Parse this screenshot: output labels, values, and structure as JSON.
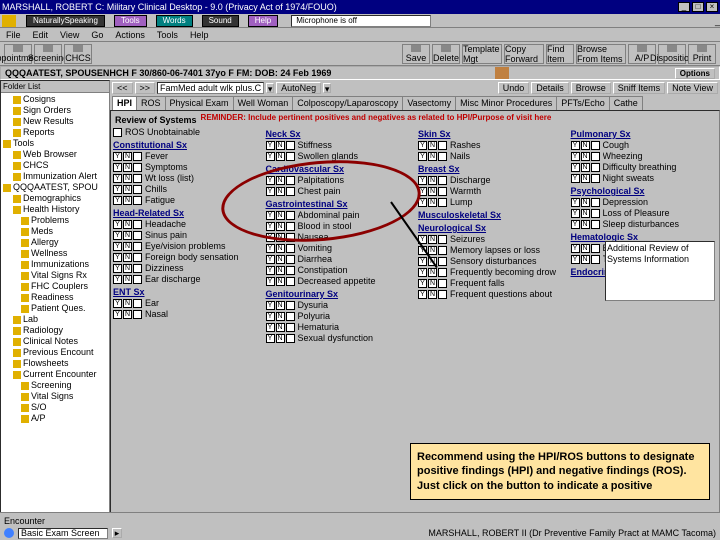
{
  "title": "MARSHALL, ROBERT C: Military Clinical Desktop - 9.0 (Privacy Act of 1974/FOUO)",
  "top_tabs": [
    "NaturallySpeaking",
    "Tools",
    "Words",
    "Sound",
    "Help"
  ],
  "mic_field": "Microphone is off",
  "menubar": [
    "File",
    "Edit",
    "View",
    "Go",
    "Actions",
    "Tools",
    "Help"
  ],
  "iconbar_left": [
    "Appointments",
    "Screening",
    "CHCS"
  ],
  "iconbar_right": [
    "Save",
    "Delete",
    "Template Mgt",
    "Copy Forward",
    "Find Item",
    "Browse From Items",
    "A/P",
    "Disposition",
    "Print"
  ],
  "patient": "QQQAATEST, SPOUSENHCH F  30/860-06-7401  37yo  F   FM:   DOB: 24 Feb 1969",
  "options_btn": "Options",
  "side_title": "Folder List",
  "tree": [
    {
      "lvl": 1,
      "label": "Cosigns"
    },
    {
      "lvl": 1,
      "label": "Sign Orders"
    },
    {
      "lvl": 1,
      "label": "New Results"
    },
    {
      "lvl": 1,
      "label": "Reports"
    },
    {
      "lvl": 0,
      "label": "Tools"
    },
    {
      "lvl": 1,
      "label": "Web Browser"
    },
    {
      "lvl": 1,
      "label": "CHCS"
    },
    {
      "lvl": 1,
      "label": "Immunization Alert"
    },
    {
      "lvl": 0,
      "label": "QQQAATEST, SPOU"
    },
    {
      "lvl": 1,
      "label": "Demographics"
    },
    {
      "lvl": 1,
      "label": "Health History"
    },
    {
      "lvl": 2,
      "label": "Problems"
    },
    {
      "lvl": 2,
      "label": "Meds"
    },
    {
      "lvl": 2,
      "label": "Allergy"
    },
    {
      "lvl": 2,
      "label": "Wellness"
    },
    {
      "lvl": 2,
      "label": "Immunizations"
    },
    {
      "lvl": 2,
      "label": "Vital Signs Rx"
    },
    {
      "lvl": 2,
      "label": "FHC Couplers"
    },
    {
      "lvl": 2,
      "label": "Readiness"
    },
    {
      "lvl": 2,
      "label": "Patient Ques."
    },
    {
      "lvl": 1,
      "label": "Lab"
    },
    {
      "lvl": 1,
      "label": "Radiology"
    },
    {
      "lvl": 1,
      "label": "Clinical Notes"
    },
    {
      "lvl": 1,
      "label": "Previous Encount"
    },
    {
      "lvl": 1,
      "label": "Flowsheets"
    },
    {
      "lvl": 1,
      "label": "Current Encounter"
    },
    {
      "lvl": 2,
      "label": "Screening"
    },
    {
      "lvl": 2,
      "label": "Vital Signs"
    },
    {
      "lvl": 2,
      "label": "S/O"
    },
    {
      "lvl": 2,
      "label": "A/P"
    }
  ],
  "nav_buttons": {
    "back": "<<",
    "fwd": ">>"
  },
  "form_dd": "FamMed adult wlk plus.C",
  "autoneg": "AutoNeg",
  "row2_buttons": [
    "Undo",
    "Details",
    "Browse",
    "Sniff Items",
    "Note View"
  ],
  "tabs": [
    "HPI",
    "ROS",
    "Physical Exam",
    "Well Woman",
    "Colposcopy/Laparoscopy",
    "Vasectomy",
    "Misc Minor Procedures",
    "PFTs/Echo",
    "Cathe"
  ],
  "active_tab": "HPI",
  "ros_title": "Review of Systems",
  "reminder": "REMINDER: Include pertinent positives and negatives as related to HPI/Purpose of visit here",
  "col1_cb": "ROS Unobtainable",
  "sections": {
    "constitutional": {
      "title": "Constitutional Sx",
      "items": [
        "Fever",
        "Symptoms",
        "Wt loss (list)",
        "Chills",
        "Fatigue"
      ]
    },
    "head": {
      "title": "Head-Related Sx",
      "items": [
        "Headache",
        "Sinus pain",
        "Eye/vision problems",
        "Foreign body sensation",
        "Dizziness",
        "Ear discharge"
      ]
    },
    "ent": {
      "title": "ENT Sx",
      "items": [
        "Ear",
        "Nasal"
      ]
    },
    "neck": {
      "title": "Neck Sx",
      "items": [
        "Stiffness",
        "Swollen glands"
      ]
    },
    "cardio": {
      "title": "Cardiovascular Sx",
      "items": [
        "Palpitations",
        "Chest pain"
      ]
    },
    "gi": {
      "title": "Gastrointestinal Sx",
      "items": [
        "Abdominal pain",
        "Blood in stool",
        "Nausea",
        "Vomiting",
        "Diarrhea",
        "Constipation",
        "Decreased appetite"
      ]
    },
    "gu": {
      "title": "Genitourinary Sx",
      "items": [
        "Dysuria",
        "Polyuria",
        "Hematuria",
        "Sexual dysfunction"
      ]
    },
    "skin": {
      "title": "Skin Sx",
      "items": [
        "Rashes",
        "Nails"
      ]
    },
    "breast": {
      "title": "Breast Sx",
      "items": [
        "Discharge",
        "Warmth",
        "Lump"
      ]
    },
    "musculo": {
      "title": "Musculoskeletal Sx"
    },
    "neuro": {
      "title": "Neurological Sx",
      "items": [
        "Seizures",
        "Memory lapses or loss",
        "Sensory disturbances",
        "Frequently becoming drow",
        "Frequent falls",
        "Frequent questions about"
      ]
    },
    "pulm": {
      "title": "Pulmonary Sx",
      "items": [
        "Cough",
        "Wheezing",
        "Difficulty breathing",
        "Night sweats"
      ]
    },
    "psych": {
      "title": "Psychological Sx",
      "items": [
        "Depression",
        "Loss of Pleasure",
        "Sleep disturbances"
      ]
    },
    "heme": {
      "title": "Hematologic Sx",
      "items": [
        "Easy bruising",
        "Tendency"
      ]
    },
    "endo": {
      "title": "Endocrine Sx",
      "items": []
    }
  },
  "addl_box_label": "Additional Review of Systems Information",
  "callout": "Recommend using the HPI/ROS buttons to designate positive findings (HPI) and negative findings (ROS). Just click on the button to indicate a positive",
  "status_label": "Encounter",
  "status_field": "Basic Exam Screen",
  "status_user": "MARSHALL, ROBERT II (Dr Preventive Family Pract at MAMC Tacoma)"
}
